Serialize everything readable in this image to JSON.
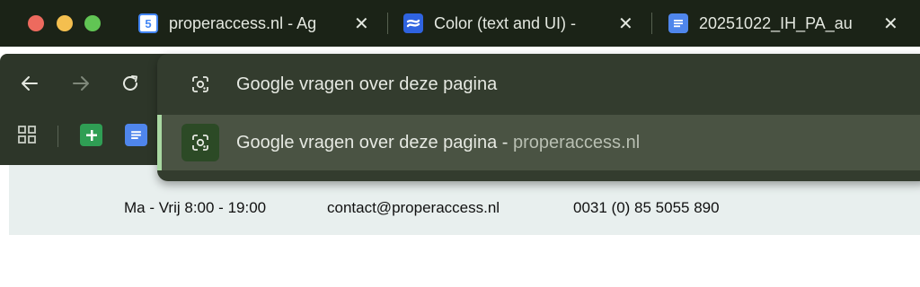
{
  "tabs": [
    {
      "title": "properaccess.nl - Ag",
      "favicon": "google-calendar-icon",
      "favicon_text": "5",
      "favicon_color": "#4285f4"
    },
    {
      "title": "Color (text and UI) -",
      "favicon": "confluence-icon",
      "favicon_color": "#2f63e0"
    },
    {
      "title": "20251022_IH_PA_au",
      "favicon": "google-docs-icon",
      "favicon_color": "#4f86ec"
    }
  ],
  "toolbar": {
    "back": "back-arrow-icon",
    "forward": "forward-arrow-icon",
    "reload": "reload-icon"
  },
  "bookmarks": [
    {
      "name": "apps-grid-icon"
    },
    {
      "name": "google-sheets-icon",
      "color": "#2f9e54"
    },
    {
      "name": "google-docs-icon",
      "color": "#4f86ec"
    }
  ],
  "omnibox": {
    "suggestion1": "Google vragen over deze pagina",
    "suggestion2_main": "Google vragen over deze pagina",
    "suggestion2_sep": " - ",
    "suggestion2_sub": "properaccess.nl"
  },
  "page": {
    "hours": "Ma - Vrij 8:00 - 19:00",
    "email": "contact@properaccess.nl",
    "phone": "0031 (0) 85 5055 890"
  },
  "colors": {
    "tab_strip": "#1b2317",
    "toolbar": "#2d3629",
    "omnibox": "#333c2e",
    "omnibox_selected": "#4a5343",
    "accent": "#a9d8a2",
    "page_banner": "#e8efee"
  }
}
